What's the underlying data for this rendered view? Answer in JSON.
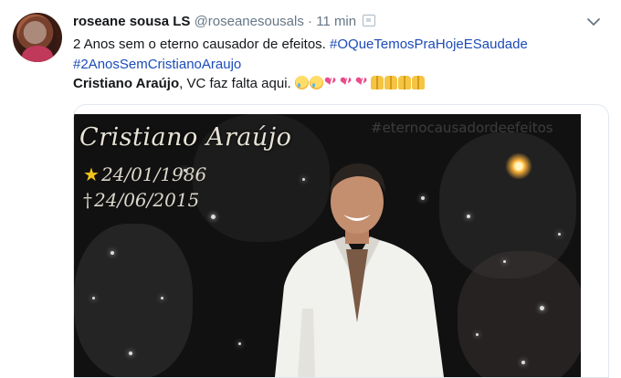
{
  "tweet": {
    "display_name": "roseane sousa LS",
    "handle": "@roseanesousals",
    "separator": "·",
    "time": "11 min",
    "line1_text": "2 Anos sem o eterno causador de efeitos. ",
    "hashtag1": "#OQueTemosPraHojeESaudade",
    "hashtag2": "#2AnosSemCristianoAraujo",
    "line3_bold": "Cristiano Araújo",
    "line3_text": ", VC faz falta aqui.",
    "emojis": [
      "crying-face",
      "crying-face",
      "broken-heart",
      "broken-heart",
      "broken-heart",
      "folded-hands",
      "folded-hands",
      "folded-hands",
      "folded-hands"
    ]
  },
  "image": {
    "title": "Cristiano Araújo",
    "born": "24/01/1986",
    "died": "24/06/2015",
    "watermark": "#eternocausadordeefeitos"
  },
  "colors": {
    "link": "#1b4bb8",
    "muted": "#657786",
    "star": "#f2c419"
  }
}
